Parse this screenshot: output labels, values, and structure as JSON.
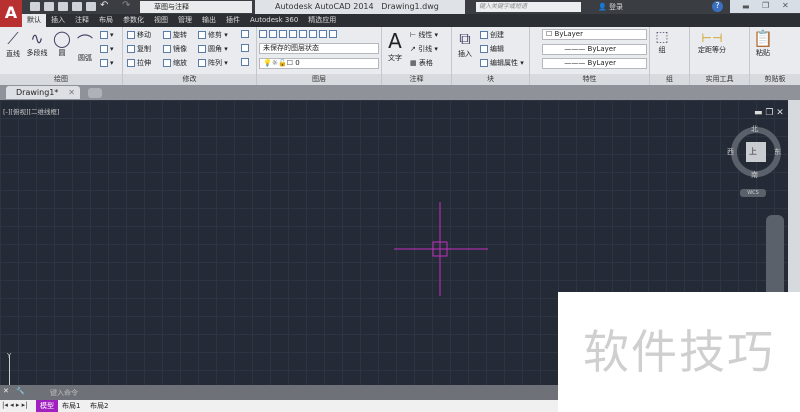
{
  "app": {
    "title": "Autodesk AutoCAD 2014",
    "document": "Drawing1.dwg",
    "workspace": "草图与注释",
    "search_placeholder": "键入关键字或短语",
    "login": "登录",
    "accent": "#b83030"
  },
  "ribbon_tabs": [
    "默认",
    "插入",
    "注释",
    "布局",
    "参数化",
    "视图",
    "管理",
    "输出",
    "插件",
    "Autodesk 360",
    "精选应用"
  ],
  "panels": {
    "draw": {
      "label": "绘图",
      "items": [
        "直线",
        "多段线",
        "圆",
        "圆弧"
      ]
    },
    "modify": {
      "label": "修改",
      "items": [
        "移动",
        "旋转",
        "修剪",
        "复制",
        "镜像",
        "圆角",
        "拉伸",
        "缩放",
        "阵列"
      ]
    },
    "layers": {
      "label": "图层",
      "layer_state": "未保存的图层状态",
      "current_layer": "0"
    },
    "annotation": {
      "label": "注释",
      "big": "文字",
      "items": [
        "线性",
        "引线",
        "表格"
      ]
    },
    "block": {
      "label": "块",
      "big": "插入",
      "items": [
        "创建",
        "编辑",
        "编辑属性"
      ]
    },
    "properties": {
      "label": "特性",
      "color": "ByLayer",
      "lineweight": "ByLayer",
      "linetype": "ByLayer"
    },
    "groups": {
      "label": "组",
      "big": "组"
    },
    "utilities": {
      "label": "实用工具",
      "big": "定距等分"
    },
    "clipboard": {
      "label": "剪贴板",
      "big": "粘贴"
    }
  },
  "document_tab": "Drawing1*",
  "viewport": {
    "label": "[-][俯视][二维线框]",
    "viewcube": {
      "top": "上",
      "north": "北",
      "south": "南",
      "east": "东",
      "west": "西",
      "ucs": "WCS"
    },
    "axis_y": "Y",
    "crosshair_color": "#c030c0"
  },
  "command": {
    "placeholder": "键入命令"
  },
  "layout_tabs": [
    "模型",
    "布局1",
    "布局2"
  ],
  "watermark": "软件技巧"
}
